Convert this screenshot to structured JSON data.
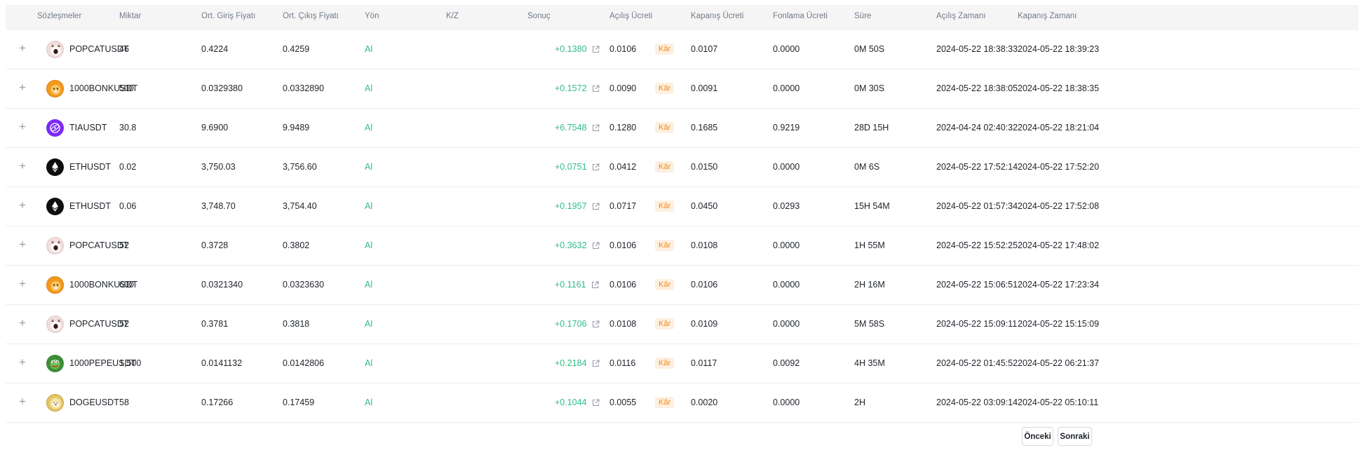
{
  "table": {
    "columns": [
      "Sözleşmeler",
      "Miktar",
      "Ort. Giriş Fiyatı",
      "Ort. Çıkış Fiyatı",
      "Yön",
      "K/Z",
      "Sonuç",
      "Açılış Ücreti",
      "Kapanış Ücreti",
      "Fonlama Ücreti",
      "Süre",
      "Açılış Zamanı",
      "Kapanış Zamanı"
    ],
    "rows": [
      {
        "coin_icon": "popcat-coin-icon",
        "symbol": "POPCATUSDT",
        "qty": "46",
        "entry": "0.4224",
        "exit": "0.4259",
        "side": "Al",
        "pnl": "+0.1380",
        "result": "Kâr",
        "open_fee": "0.0106",
        "close_fee": "0.0107",
        "funding": "0.0000",
        "duration": "0M 50S",
        "open_time": "2024-05-22 18:38:33",
        "close_time": "2024-05-22 18:39:23"
      },
      {
        "coin_icon": "bonk-coin-icon",
        "symbol": "1000BONKUSDT",
        "qty": "500",
        "entry": "0.0329380",
        "exit": "0.0332890",
        "side": "Al",
        "pnl": "+0.1572",
        "result": "Kâr",
        "open_fee": "0.0090",
        "close_fee": "0.0091",
        "funding": "0.0000",
        "duration": "0M 30S",
        "open_time": "2024-05-22 18:38:05",
        "close_time": "2024-05-22 18:38:35"
      },
      {
        "coin_icon": "tia-coin-icon",
        "symbol": "TIAUSDT",
        "qty": "30.8",
        "entry": "9.6900",
        "exit": "9.9489",
        "side": "Al",
        "pnl": "+6.7548",
        "result": "Kâr",
        "open_fee": "0.1280",
        "close_fee": "0.1685",
        "funding": "0.9219",
        "duration": "28D 15H",
        "open_time": "2024-04-24 02:40:32",
        "close_time": "2024-05-22 18:21:04"
      },
      {
        "coin_icon": "eth-coin-icon",
        "symbol": "ETHUSDT",
        "qty": "0.02",
        "entry": "3,750.03",
        "exit": "3,756.60",
        "side": "Al",
        "pnl": "+0.0751",
        "result": "Kâr",
        "open_fee": "0.0412",
        "close_fee": "0.0150",
        "funding": "0.0000",
        "duration": "0M 6S",
        "open_time": "2024-05-22 17:52:14",
        "close_time": "2024-05-22 17:52:20"
      },
      {
        "coin_icon": "eth-coin-icon",
        "symbol": "ETHUSDT",
        "qty": "0.06",
        "entry": "3,748.70",
        "exit": "3,754.40",
        "side": "Al",
        "pnl": "+0.1957",
        "result": "Kâr",
        "open_fee": "0.0717",
        "close_fee": "0.0450",
        "funding": "0.0293",
        "duration": "15H 54M",
        "open_time": "2024-05-22 01:57:34",
        "close_time": "2024-05-22 17:52:08"
      },
      {
        "coin_icon": "popcat-coin-icon",
        "symbol": "POPCATUSDT",
        "qty": "52",
        "entry": "0.3728",
        "exit": "0.3802",
        "side": "Al",
        "pnl": "+0.3632",
        "result": "Kâr",
        "open_fee": "0.0106",
        "close_fee": "0.0108",
        "funding": "0.0000",
        "duration": "1H 55M",
        "open_time": "2024-05-22 15:52:25",
        "close_time": "2024-05-22 17:48:02"
      },
      {
        "coin_icon": "bonk-coin-icon",
        "symbol": "1000BONKUSDT",
        "qty": "600",
        "entry": "0.0321340",
        "exit": "0.0323630",
        "side": "Al",
        "pnl": "+0.1161",
        "result": "Kâr",
        "open_fee": "0.0106",
        "close_fee": "0.0106",
        "funding": "0.0000",
        "duration": "2H 16M",
        "open_time": "2024-05-22 15:06:51",
        "close_time": "2024-05-22 17:23:34"
      },
      {
        "coin_icon": "popcat-coin-icon",
        "symbol": "POPCATUSDT",
        "qty": "52",
        "entry": "0.3781",
        "exit": "0.3818",
        "side": "Al",
        "pnl": "+0.1706",
        "result": "Kâr",
        "open_fee": "0.0108",
        "close_fee": "0.0109",
        "funding": "0.0000",
        "duration": "5M 58S",
        "open_time": "2024-05-22 15:09:11",
        "close_time": "2024-05-22 15:15:09"
      },
      {
        "coin_icon": "pepe-coin-icon",
        "symbol": "1000PEPEUSDT",
        "qty": "1,500",
        "entry": "0.0141132",
        "exit": "0.0142806",
        "side": "Al",
        "pnl": "+0.2184",
        "result": "Kâr",
        "open_fee": "0.0116",
        "close_fee": "0.0117",
        "funding": "0.0092",
        "duration": "4H 35M",
        "open_time": "2024-05-22 01:45:52",
        "close_time": "2024-05-22 06:21:37"
      },
      {
        "coin_icon": "doge-coin-icon",
        "symbol": "DOGEUSDT",
        "qty": "58",
        "entry": "0.17266",
        "exit": "0.17459",
        "side": "Al",
        "pnl": "+0.1044",
        "result": "Kâr",
        "open_fee": "0.0055",
        "close_fee": "0.0020",
        "funding": "0.0000",
        "duration": "2H",
        "open_time": "2024-05-22 03:09:14",
        "close_time": "2024-05-22 05:10:11"
      }
    ]
  },
  "pagination": {
    "prev_label": "Önceki",
    "next_label": "Sonraki"
  },
  "colors": {
    "profit_green": "#2ebd85",
    "badge_bg": "#fdf0e0",
    "badge_text": "#ef8a1d",
    "header_bg": "#f5f5f5"
  },
  "icons": {
    "expand": "plus-icon",
    "pnl_link": "external-link-icon"
  }
}
